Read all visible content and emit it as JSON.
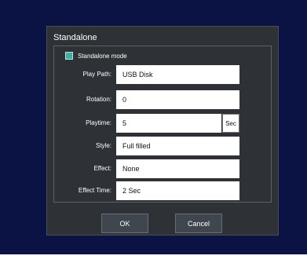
{
  "dialog": {
    "title": "Standalone"
  },
  "standalone_mode": {
    "label": "Standalone mode",
    "checked": true,
    "check_color": "#38b2a4"
  },
  "fields": {
    "play_path": {
      "label": "Play Path:",
      "value": "USB Disk"
    },
    "rotation": {
      "label": "Rotation:",
      "value": "0"
    },
    "playtime": {
      "label": "Playtime:",
      "value": "5",
      "unit": "Sec"
    },
    "style": {
      "label": "Style:",
      "value": "Full filled"
    },
    "effect": {
      "label": "Effect:",
      "value": "None"
    },
    "effect_time": {
      "label": "Effect Time:",
      "value": "2 Sec"
    }
  },
  "buttons": {
    "ok": "OK",
    "cancel": "Cancel"
  },
  "colors": {
    "backdrop": "#0b1244",
    "dialog": "#2e3237",
    "accent": "#38b2a4"
  }
}
